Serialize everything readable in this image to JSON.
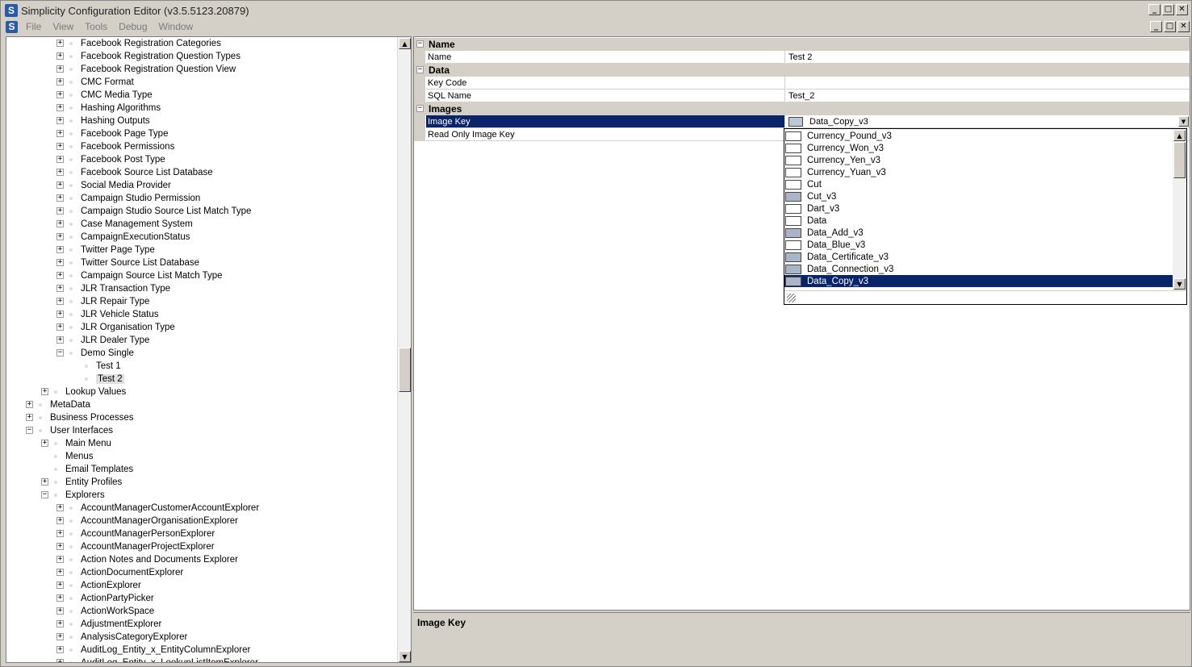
{
  "window": {
    "title": "Simplicity Configuration Editor (v3.5.5123.20879)",
    "controls": [
      "_",
      "□",
      "✕"
    ]
  },
  "menubar": {
    "items": [
      "File",
      "View",
      "Tools",
      "Debug",
      "Window"
    ]
  },
  "tree": {
    "items": [
      {
        "label": "Facebook Registration Categories",
        "level": 3,
        "state": "plus"
      },
      {
        "label": "Facebook Registration Question Types",
        "level": 3,
        "state": "plus"
      },
      {
        "label": "Facebook Registration Question View",
        "level": 3,
        "state": "plus"
      },
      {
        "label": "CMC Format",
        "level": 3,
        "state": "plus"
      },
      {
        "label": "CMC Media Type",
        "level": 3,
        "state": "plus"
      },
      {
        "label": "Hashing Algorithms",
        "level": 3,
        "state": "plus"
      },
      {
        "label": "Hashing Outputs",
        "level": 3,
        "state": "plus"
      },
      {
        "label": "Facebook Page Type",
        "level": 3,
        "state": "plus"
      },
      {
        "label": "Facebook Permissions",
        "level": 3,
        "state": "plus"
      },
      {
        "label": "Facebook Post Type",
        "level": 3,
        "state": "plus"
      },
      {
        "label": "Facebook Source List Database",
        "level": 3,
        "state": "plus"
      },
      {
        "label": "Social Media Provider",
        "level": 3,
        "state": "plus"
      },
      {
        "label": "Campaign Studio Permission",
        "level": 3,
        "state": "plus"
      },
      {
        "label": "Campaign Studio Source List Match Type",
        "level": 3,
        "state": "plus"
      },
      {
        "label": "Case Management System",
        "level": 3,
        "state": "plus"
      },
      {
        "label": "CampaignExecutionStatus",
        "level": 3,
        "state": "plus"
      },
      {
        "label": "Twitter Page Type",
        "level": 3,
        "state": "plus"
      },
      {
        "label": "Twitter Source List Database",
        "level": 3,
        "state": "plus"
      },
      {
        "label": "Campaign Source List Match Type",
        "level": 3,
        "state": "plus"
      },
      {
        "label": "JLR Transaction Type",
        "level": 3,
        "state": "plus"
      },
      {
        "label": "JLR Repair Type",
        "level": 3,
        "state": "plus"
      },
      {
        "label": "JLR Vehicle Status",
        "level": 3,
        "state": "plus"
      },
      {
        "label": "JLR Organisation Type",
        "level": 3,
        "state": "plus"
      },
      {
        "label": "JLR Dealer Type",
        "level": 3,
        "state": "plus"
      },
      {
        "label": "Demo Single",
        "level": 3,
        "state": "minus"
      },
      {
        "label": "Test 1",
        "level": 4,
        "state": "leaf"
      },
      {
        "label": "Test 2",
        "level": 4,
        "state": "leaf",
        "selected": true
      },
      {
        "label": "Lookup Values",
        "level": 2,
        "state": "plus"
      },
      {
        "label": "MetaData",
        "level": 1,
        "state": "plus"
      },
      {
        "label": "Business Processes",
        "level": 1,
        "state": "plus"
      },
      {
        "label": "User Interfaces",
        "level": 1,
        "state": "minus"
      },
      {
        "label": "Main Menu",
        "level": 2,
        "state": "plus"
      },
      {
        "label": "Menus",
        "level": 2,
        "state": "leaf"
      },
      {
        "label": "Email Templates",
        "level": 2,
        "state": "leaf"
      },
      {
        "label": "Entity Profiles",
        "level": 2,
        "state": "plus"
      },
      {
        "label": "Explorers",
        "level": 2,
        "state": "minus"
      },
      {
        "label": "AccountManagerCustomerAccountExplorer",
        "level": 3,
        "state": "plus"
      },
      {
        "label": "AccountManagerOrganisationExplorer",
        "level": 3,
        "state": "plus"
      },
      {
        "label": "AccountManagerPersonExplorer",
        "level": 3,
        "state": "plus"
      },
      {
        "label": "AccountManagerProjectExplorer",
        "level": 3,
        "state": "plus"
      },
      {
        "label": "Action Notes and Documents Explorer",
        "level": 3,
        "state": "plus"
      },
      {
        "label": "ActionDocumentExplorer",
        "level": 3,
        "state": "plus"
      },
      {
        "label": "ActionExplorer",
        "level": 3,
        "state": "plus"
      },
      {
        "label": "ActionPartyPicker",
        "level": 3,
        "state": "plus"
      },
      {
        "label": "ActionWorkSpace",
        "level": 3,
        "state": "plus"
      },
      {
        "label": "AdjustmentExplorer",
        "level": 3,
        "state": "plus"
      },
      {
        "label": "AnalysisCategoryExplorer",
        "level": 3,
        "state": "plus"
      },
      {
        "label": "AuditLog_Entity_x_EntityColumnExplorer",
        "level": 3,
        "state": "plus"
      },
      {
        "label": "AuditLog_Entity_x_LookupListItemExplorer",
        "level": 3,
        "state": "plus"
      }
    ]
  },
  "propertygrid": {
    "categories": [
      {
        "name": "Name",
        "props": [
          {
            "name": "Name",
            "value": "Test 2"
          }
        ]
      },
      {
        "name": "Data",
        "props": [
          {
            "name": "Key Code",
            "value": ""
          },
          {
            "name": "SQL Name",
            "value": "Test_2"
          }
        ]
      },
      {
        "name": "Images",
        "props": [
          {
            "name": "Image Key",
            "value": "Data_Copy_v3",
            "selected": true
          },
          {
            "name": "Read Only Image Key",
            "value": ""
          }
        ]
      }
    ]
  },
  "dropdown": {
    "items": [
      {
        "label": "Currency_Pound_v3",
        "pic": false
      },
      {
        "label": "Currency_Won_v3",
        "pic": false
      },
      {
        "label": "Currency_Yen_v3",
        "pic": false
      },
      {
        "label": "Currency_Yuan_v3",
        "pic": false
      },
      {
        "label": "Cut",
        "pic": false
      },
      {
        "label": "Cut_v3",
        "pic": true
      },
      {
        "label": "Dart_v3",
        "pic": false
      },
      {
        "label": "Data",
        "pic": false
      },
      {
        "label": "Data_Add_v3",
        "pic": true
      },
      {
        "label": "Data_Blue_v3",
        "pic": false
      },
      {
        "label": "Data_Certificate_v3",
        "pic": true
      },
      {
        "label": "Data_Connection_v3",
        "pic": true
      },
      {
        "label": "Data_Copy_v3",
        "pic": true,
        "selected": true
      }
    ]
  },
  "help": {
    "title": "Image Key"
  }
}
